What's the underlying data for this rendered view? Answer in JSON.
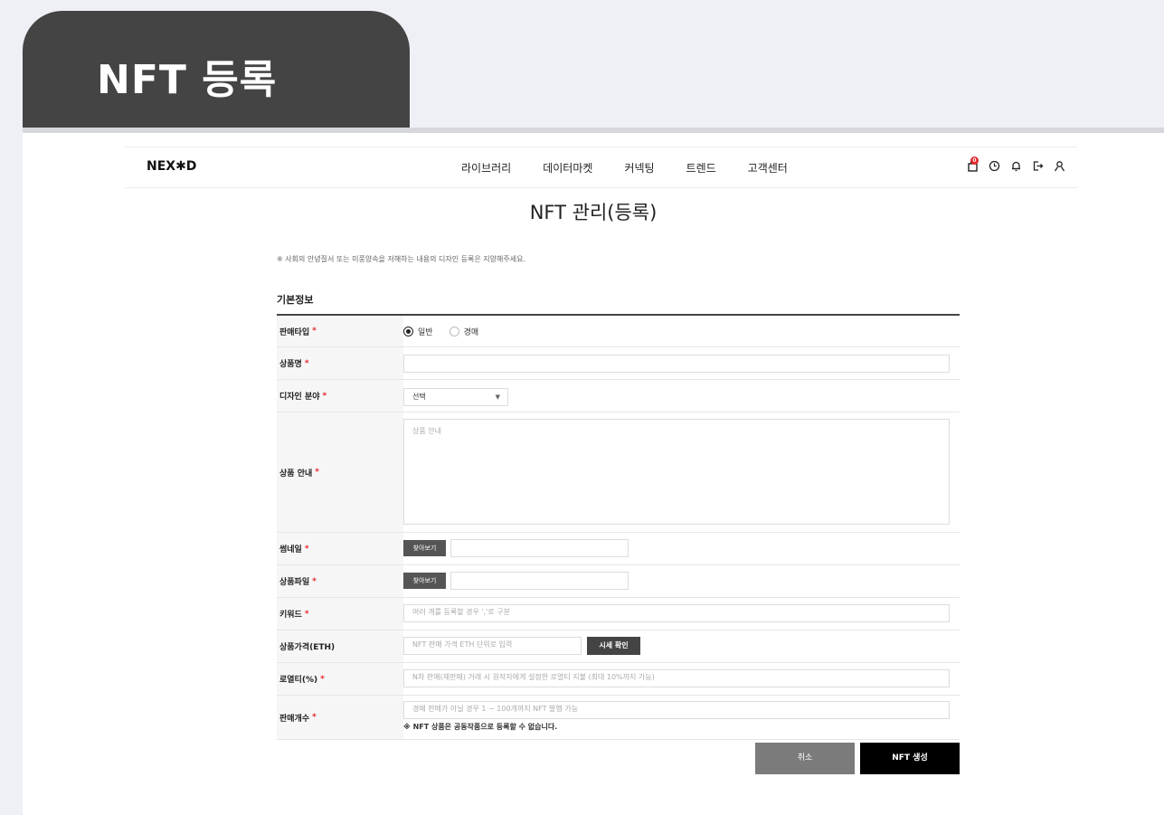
{
  "banner": {
    "title": "NFT 등록"
  },
  "header": {
    "logo": "NEX✱D",
    "menu": [
      "라이브러리",
      "데이터마켓",
      "커넥팅",
      "트렌드",
      "고객센터"
    ],
    "cart_badge": "0"
  },
  "page": {
    "title": "NFT 관리(등록)",
    "notice": "※ 사회의 안녕질서 또는 미풍양속을 저해하는 내용의 디자인 등록은 지양해주세요.",
    "section_title": "기본정보"
  },
  "form": {
    "sale_type": {
      "label": "판매타입",
      "options": [
        "일반",
        "경매"
      ],
      "selected": "일반"
    },
    "product_name": {
      "label": "상품명",
      "value": ""
    },
    "design_field": {
      "label": "디자인 분야",
      "value": "선택"
    },
    "product_desc": {
      "label": "상품 안내",
      "placeholder": "상품 안내"
    },
    "thumbnail": {
      "label": "썸네일",
      "button": "찾아보기"
    },
    "product_file": {
      "label": "상품파일",
      "button": "찾아보기"
    },
    "keyword": {
      "label": "키워드",
      "placeholder": "여러 개를 등록할 경우 ','로 구분"
    },
    "price": {
      "label": "상품가격(ETH)",
      "placeholder": "NFT 판매 가격 ETH 단위로 입력",
      "button": "시세 확인"
    },
    "royalty": {
      "label": "로열티(%)",
      "placeholder": "N차 판매(재판매) 거래 시 원작자에게 설정한 로열티 지불 (최대 10%까지 가능)"
    },
    "quantity": {
      "label": "판매개수",
      "placeholder": "경매 판매가 아닐 경우 1 ~ 100개까지 NFT 발행 가능",
      "helper": "※ NFT 상품은 공동작품으로 등록할 수 없습니다."
    },
    "required_mark": "*"
  },
  "actions": {
    "cancel": "취소",
    "create": "NFT 생성"
  }
}
